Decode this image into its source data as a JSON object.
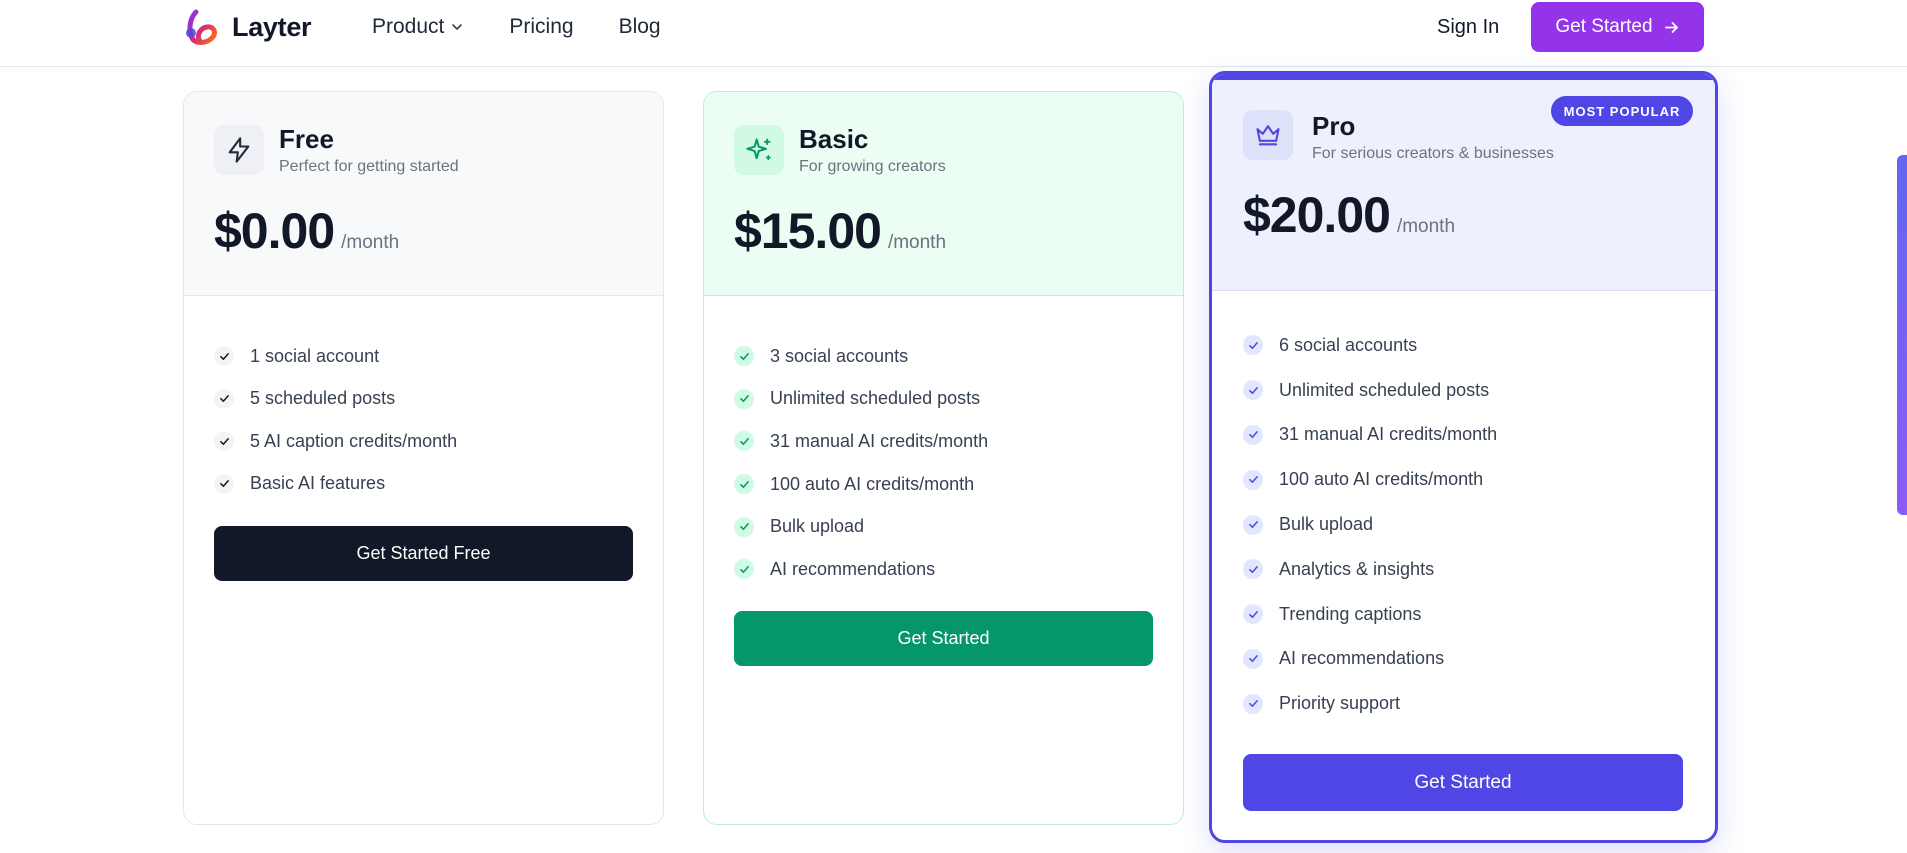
{
  "header": {
    "brand": "Layter",
    "nav": [
      {
        "label": "Product"
      },
      {
        "label": "Pricing"
      },
      {
        "label": "Blog"
      }
    ],
    "signin": "Sign In",
    "cta": "Get Started"
  },
  "plans": [
    {
      "name": "Free",
      "subtitle": "Perfect for getting started",
      "price": "$0.00",
      "period": "/month",
      "features": [
        "1 social account",
        "5 scheduled posts",
        "5 AI caption credits/month",
        "Basic AI features"
      ],
      "cta": "Get Started Free"
    },
    {
      "name": "Basic",
      "subtitle": "For growing creators",
      "price": "$15.00",
      "period": "/month",
      "features": [
        "3 social accounts",
        "Unlimited scheduled posts",
        "31 manual AI credits/month",
        "100 auto AI credits/month",
        "Bulk upload",
        "AI recommendations"
      ],
      "cta": "Get Started"
    },
    {
      "name": "Pro",
      "subtitle": "For serious creators & businesses",
      "badge": "MOST POPULAR",
      "price": "$20.00",
      "period": "/month",
      "features": [
        "6 social accounts",
        "Unlimited scheduled posts",
        "31 manual AI credits/month",
        "100 auto AI credits/month",
        "Bulk upload",
        "Analytics & insights",
        "Trending captions",
        "AI recommendations",
        "Priority support"
      ],
      "cta": "Get Started"
    }
  ],
  "colors": {
    "brand_purple": "#9333ea",
    "free_button": "#111827",
    "basic_accent": "#059669",
    "pro_accent": "#4f46e5"
  },
  "icons": {
    "free": "lightning-icon",
    "basic": "sparkle-icon",
    "pro": "crown-icon"
  }
}
